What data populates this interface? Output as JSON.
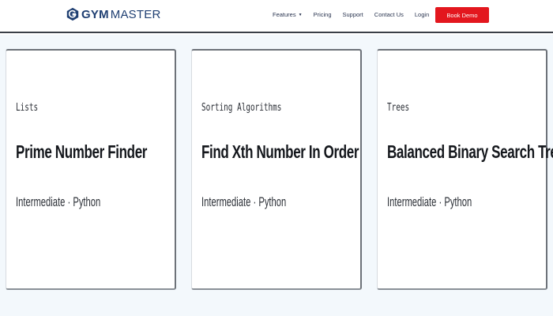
{
  "header": {
    "logo": {
      "gym": "GYM",
      "master": "MASTER",
      "brand_color": "#1f3f72"
    },
    "nav": [
      {
        "label": "Features",
        "has_dropdown": true
      },
      {
        "label": "Pricing"
      },
      {
        "label": "Support"
      },
      {
        "label": "Contact Us"
      },
      {
        "label": "Login"
      }
    ],
    "cta": {
      "label": "Book Demo",
      "color": "#e3171e"
    }
  },
  "cards": [
    {
      "category": "Lists",
      "title": "Prime Number Finder",
      "meta": "Intermediate · Python"
    },
    {
      "category": "Sorting Algorithms",
      "title": "Find Xth Number In Order",
      "meta": "Intermediate · Python"
    },
    {
      "category": "Trees",
      "title": "Balanced Binary Search Tree",
      "meta": "Intermediate · Python"
    }
  ],
  "colors": {
    "page_background": "#f3f8fc",
    "card_background": "#ffffff"
  }
}
